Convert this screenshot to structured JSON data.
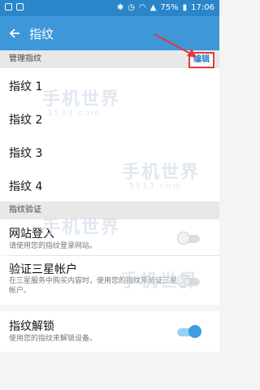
{
  "status_bar": {
    "battery_percent": "75%",
    "time": "17:06"
  },
  "app_bar": {
    "title": "指纹",
    "back_icon": "arrow-left-icon"
  },
  "manage_section": {
    "header": "管理指纹",
    "edit_label": "编辑",
    "fingerprints": [
      "指纹 1",
      "指纹 2",
      "指纹 3",
      "指纹 4"
    ]
  },
  "verify_section": {
    "header": "指纹验证",
    "website_login": {
      "title": "网站登入",
      "subtitle": "请使用您的指纹登录网站。",
      "enabled": false
    },
    "samsung_account": {
      "title": "验证三星帐户",
      "subtitle": "在三星服务中购买内容时，使用您的指纹来验证三星帐户。",
      "enabled": false
    }
  },
  "unlock": {
    "title": "指纹解锁",
    "subtitle": "使用您的指纹来解锁设备。",
    "enabled": true
  },
  "watermark": {
    "text": "手机世界",
    "subtext": "3533.com"
  },
  "colors": {
    "app_bar": "#3d97d8",
    "status_bar": "#2a86c8",
    "accent": "#3c9de0",
    "highlight": "#e53935"
  }
}
